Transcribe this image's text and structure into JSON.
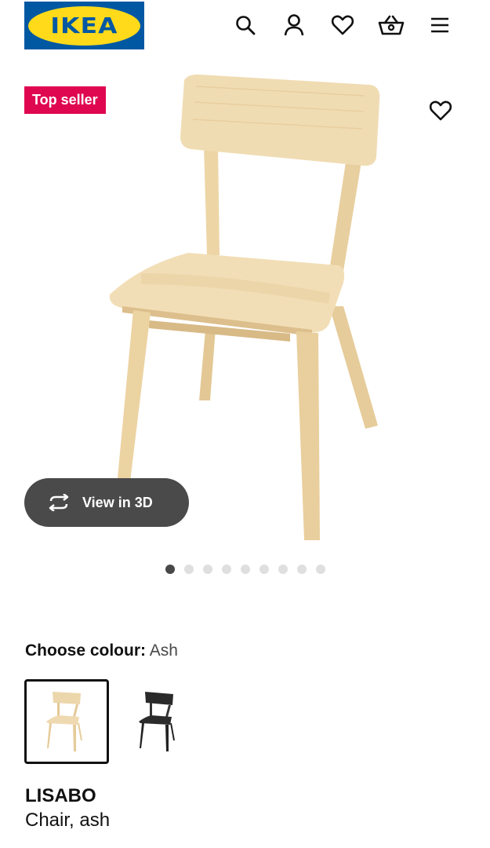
{
  "header": {
    "logo_text": "IKEA",
    "icons": [
      "search-icon",
      "account-icon",
      "favourites-icon",
      "basket-icon",
      "menu-icon"
    ]
  },
  "colors": {
    "brand_blue": "#0058a3",
    "brand_yellow": "#ffda1a",
    "badge_red": "#e00751",
    "view3d_bg": "#4a4a4a"
  },
  "product": {
    "badge": "Top seller",
    "view_3d_label": "View in 3D",
    "gallery_dots": {
      "count": 9,
      "active": 1
    },
    "choose_colour_label": "Choose colour:",
    "selected_colour": "Ash",
    "name": "LISABO",
    "description": "Chair, ash"
  }
}
